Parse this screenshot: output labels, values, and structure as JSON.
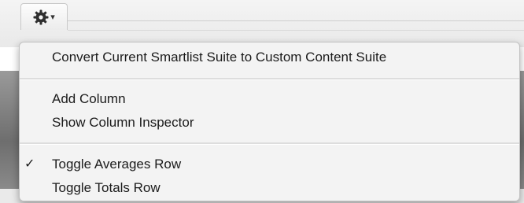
{
  "toolbar": {
    "action_button_icon": "gear-icon",
    "dropdown_icon": "chevron-down-icon"
  },
  "menu": {
    "items": [
      {
        "label": "Convert Current Smartlist Suite to Custom Content Suite",
        "checked": false
      },
      {
        "label": "Add Column",
        "checked": false
      },
      {
        "label": "Show Column Inspector",
        "checked": false
      },
      {
        "label": "Toggle Averages Row",
        "checked": true
      },
      {
        "label": "Toggle Totals Row",
        "checked": false
      }
    ],
    "checkmark": "✓"
  }
}
